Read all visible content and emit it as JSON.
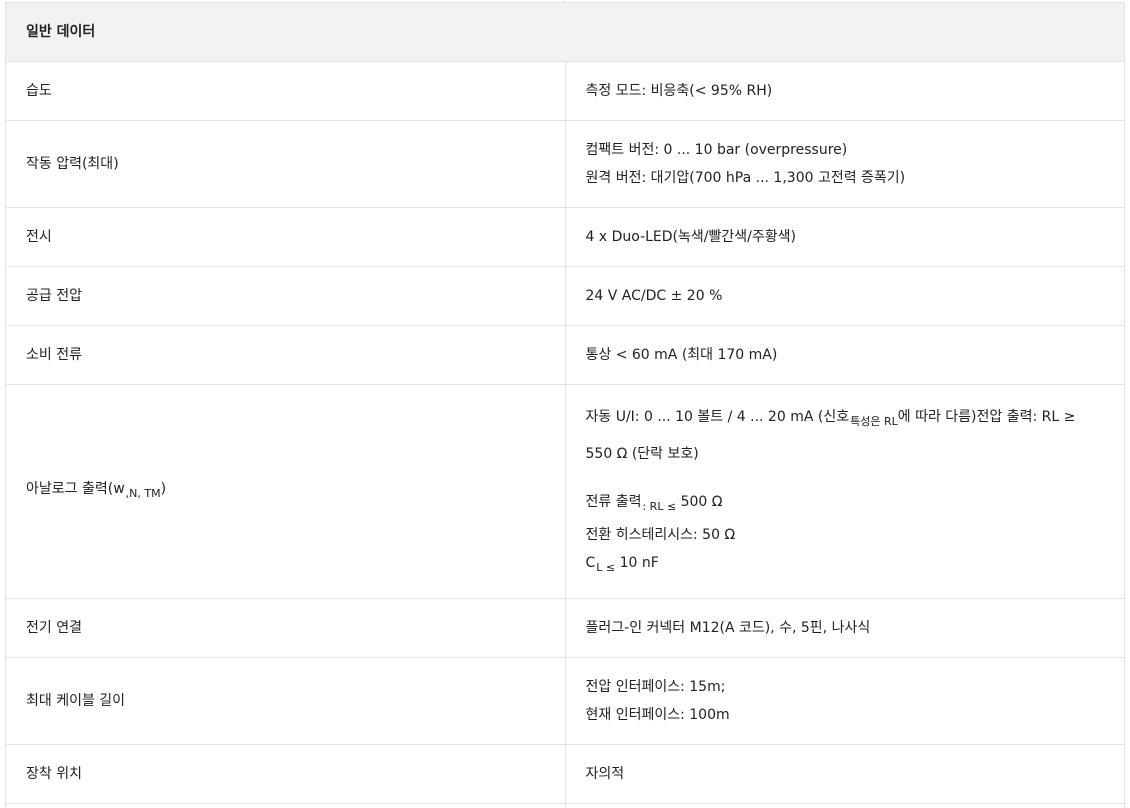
{
  "table": {
    "header": "일반 데이터",
    "rows": [
      {
        "label": "습도",
        "value": "측정 모드: 비응축(< 95% RH)"
      },
      {
        "label": "작동 압력(최대)",
        "lines": [
          "컴팩트 버전: 0 ... 10 bar (overpressure)",
          "원격 버전: 대기압(700 hPa ... 1,300 고전력 증폭기)"
        ]
      },
      {
        "label": "전시",
        "value": "4 x Duo-LED(녹색/빨간색/주황색)"
      },
      {
        "label": "공급 전압",
        "value": "24 V AC/DC ± 20 %"
      },
      {
        "label": "소비 전류",
        "value": "통상 < 60 mA (최대 170 mA)"
      },
      {
        "label_main": "아날로그 출력(w",
        "label_sub": ",N, TM",
        "label_end": ")",
        "line1_a": "자동 U/I: 0 ... 10 볼트 / 4 ... 20 mA (신호",
        "line1_sub": "특성은 RL",
        "line1_b": "에 따라 다름)전압 출력: RL ≥",
        "line2": "550 Ω (단락 보호)",
        "line3_a": "전류 출력",
        "line3_sub": ": RL ≤",
        "line3_b": " 500 Ω",
        "line4": "전환 히스테리시스: 50 Ω",
        "line5_a": "C",
        "line5_sub": "L ≤",
        "line5_b": " 10 nF"
      },
      {
        "label": "전기 연결",
        "value": "플러그-인 커넥터 M12(A 코드), 수, 5핀, 나사식"
      },
      {
        "label": "최대 케이블 길이",
        "lines": [
          "전압 인터페이스: 15m;",
          "현재 인터페이스: 100m"
        ]
      },
      {
        "label": "장착 위치",
        "value": "자의적"
      }
    ]
  }
}
